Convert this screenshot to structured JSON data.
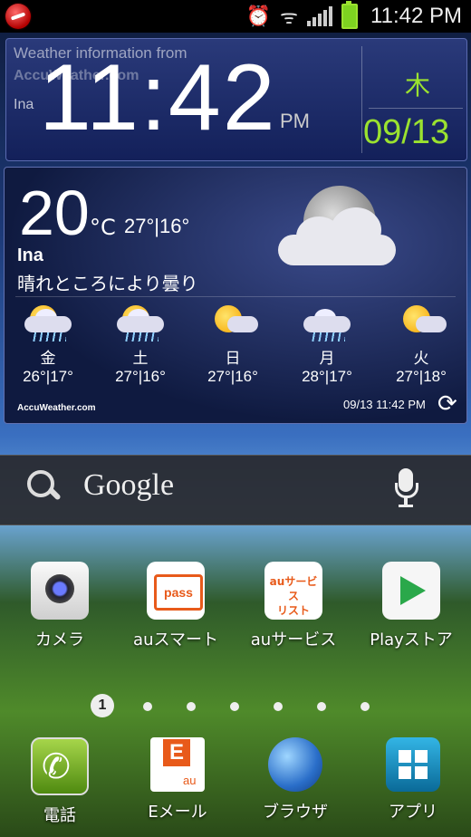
{
  "status_bar": {
    "time": "11:42 PM",
    "alarm_icon": "alarm-icon",
    "wifi_icon": "wifi-icon",
    "signal_icon": "signal-icon",
    "battery_icon": "battery-icon"
  },
  "clock_widget": {
    "info_text": "Weather information from",
    "brand_watermark": "AccuWeather.com",
    "location": "Ina",
    "time": "11:42",
    "ampm": "PM",
    "day": "木",
    "date": "09/13"
  },
  "weather_widget": {
    "temperature": "20",
    "unit": "°C",
    "high_low": "27°|16°",
    "city": "Ina",
    "condition": "晴れところにより曇り",
    "forecast": [
      {
        "day": "金",
        "temps": "26°|17°",
        "icon": "rain-cloud-icon"
      },
      {
        "day": "土",
        "temps": "27°|16°",
        "icon": "rain-sun-icon"
      },
      {
        "day": "日",
        "temps": "27°|16°",
        "icon": "sun-cloud-icon"
      },
      {
        "day": "月",
        "temps": "28°|17°",
        "icon": "rain-cloud-icon"
      },
      {
        "day": "火",
        "temps": "27°|18°",
        "icon": "sun-cloud-icon"
      }
    ],
    "brand": "AccuWeather.com",
    "updated": "09/13 11:42 PM"
  },
  "search": {
    "label": "Google"
  },
  "apps": [
    {
      "label": "カメラ",
      "icon": "camera-icon"
    },
    {
      "label": "auスマート",
      "icon": "au-pass-icon",
      "icon_text": "pass"
    },
    {
      "label": "auサービス",
      "icon": "au-service-list-icon",
      "icon_text_1": "auサービス",
      "icon_text_2": "リスト"
    },
    {
      "label": "Playストア",
      "icon": "play-store-icon"
    }
  ],
  "pager": {
    "current": "1",
    "total_dots": 7
  },
  "dock": [
    {
      "label": "電話",
      "icon": "phone-icon"
    },
    {
      "label": "Eメール",
      "icon": "email-icon",
      "icon_text": "E",
      "sub": "au"
    },
    {
      "label": "ブラウザ",
      "icon": "globe-icon"
    },
    {
      "label": "アプリ",
      "icon": "apps-grid-icon"
    }
  ]
}
